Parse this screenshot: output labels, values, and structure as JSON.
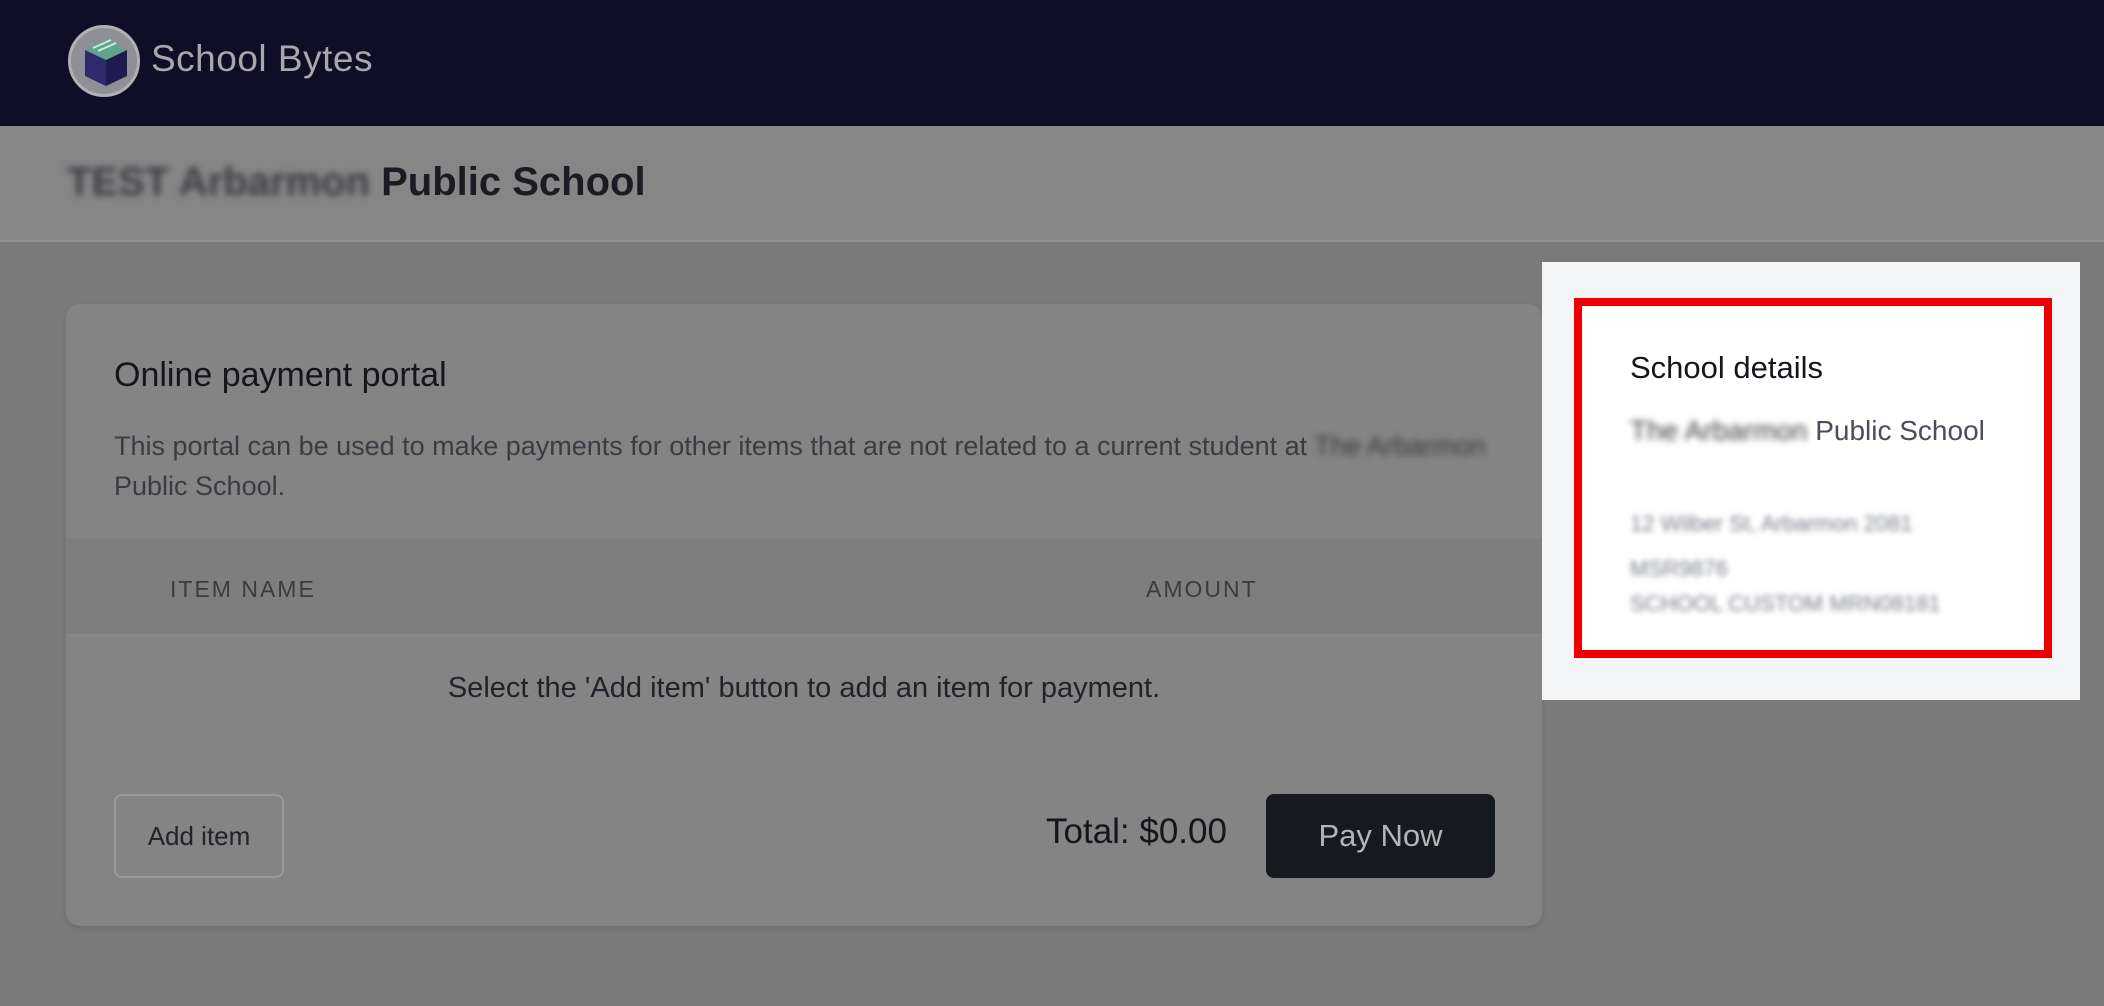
{
  "header": {
    "brand": "School Bytes",
    "logo_icon": "book-cube-logo-icon"
  },
  "school": {
    "name_blurred": "TEST Arbarmon",
    "name_suffix": " Public School"
  },
  "portal": {
    "title": "Online payment portal",
    "description_start": "This portal can be used to make payments for other items that are not related to a current student at ",
    "description_blurred": "The Arbarmon",
    "description_end": " Public School.",
    "columns": [
      "ITEM NAME",
      "AMOUNT"
    ],
    "empty_message": "Select the 'Add item' button to add an item for payment.",
    "add_button": "Add item",
    "total": "Total: $0.00",
    "pay_button": "Pay Now"
  },
  "details": {
    "title": "School details",
    "name_blurred": "The Arbarmon",
    "name_suffix": " Public School",
    "address_blurred": "12 Wilber St, Arbarmon 2081",
    "code_blurred": "MSR9876",
    "extra_blurred": "SCHOOL CUSTOM MRN08181"
  },
  "colors": {
    "topbar": "#0f0e26",
    "highlight_border": "#ee0000",
    "pay_button": "#161a1f"
  }
}
